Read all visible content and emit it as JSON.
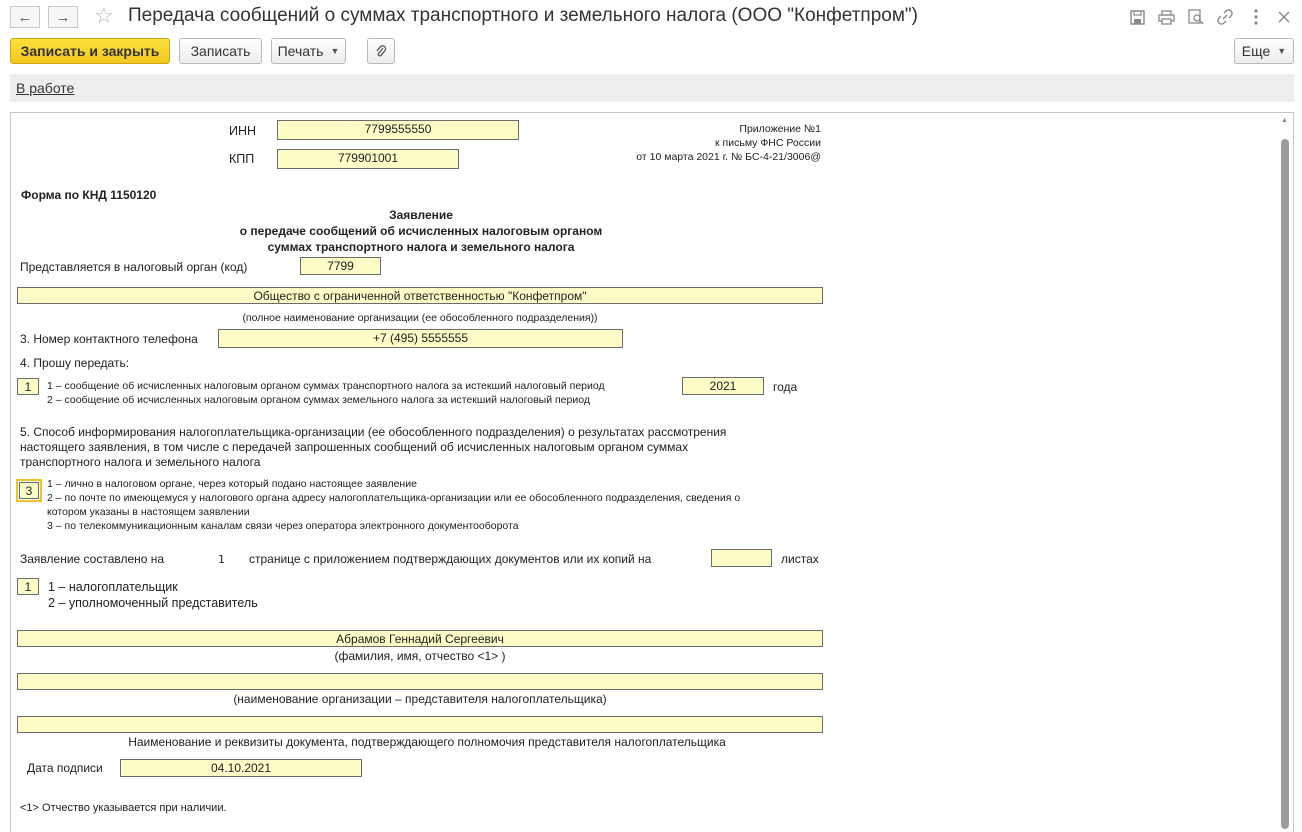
{
  "window": {
    "title": "Передача сообщений о суммах транспортного и земельного налога (ООО \"Конфетпром\")",
    "back_icon": "←",
    "forward_icon": "→",
    "star_icon": "☆"
  },
  "toolbar": {
    "save_close_label": "Записать и закрыть",
    "save_label": "Записать",
    "print_label": "Печать",
    "attach_icon": "paperclip",
    "more_label": "Еще"
  },
  "status": {
    "link_label": "В работе"
  },
  "form": {
    "inn_label": "ИНН",
    "inn_value": "7799555550",
    "kpp_label": "КПП",
    "kpp_value": "779901001",
    "appendix_line1": "Приложение №1",
    "appendix_line2": "к письму ФНС России",
    "appendix_line3": "от 10 марта 2021 г. № БС-4-21/3006@",
    "form_code": "Форма по КНД 1150120",
    "heading_line1": "Заявление",
    "heading_line2": "о передаче сообщений об исчисленных налоговым органом",
    "heading_line3": "суммах транспортного налога и земельного налога",
    "tax_authority_label": "Представляется в налоговый орган (код)",
    "tax_authority_value": "7799",
    "org_name_value": "Общество с ограниченной ответственностью \"Конфетпром\"",
    "org_name_caption": "(полное наименование организации (ее обособленного подразделения))",
    "phone_label": "3. Номер контактного телефона",
    "phone_value": "+7 (495) 5555555",
    "request_label": "4. Прошу передать:",
    "request_value": "1",
    "request_opt1": "1 – сообщение об исчисленных налоговым органом суммах транспортного налога за истекший налоговый период",
    "request_opt2": "2 – сообщение об исчисленных налоговым органом суммах земельного налога за истекший налоговый период",
    "year_value": "2021",
    "year_label": "года",
    "inform_line1": "5. Способ информирования налогоплательщика-организации (ее обособленного подразделения) о результатах рассмотрения",
    "inform_line2": "настоящего заявления, в том числе с передачей запрошенных сообщений об исчисленных налоговым органом суммах",
    "inform_line3": "транспортного налога и земельного налога",
    "inform_value": "3",
    "inform_opt1": "1 – лично в налоговом органе, через который подано настоящее заявление",
    "inform_opt2a": "2 – по почте по имеющемуся у налогового органа адресу налогоплательщика-организации или ее обособленного подразделения, сведения о",
    "inform_opt2b": "котором указаны в настоящем заявлении",
    "inform_opt3": "3 – по телекоммуникационным каналам связи через оператора электронного документооборота",
    "pages_label": "Заявление составлено на",
    "pages_value": "1",
    "pages_text": "странице с приложением подтверждающих документов или их копий на",
    "attach_pages_value": "",
    "attach_pages_label": "листах",
    "signer_value": "1",
    "signer_opt1": "1 – налогоплательщик",
    "signer_opt2": "2 – уполномоченный представитель",
    "fio_value": "Абрамов Геннадий Сергеевич",
    "fio_caption": "(фамилия, имя, отчество <1> )",
    "rep_org_value": "",
    "rep_org_caption": "(наименование организации – представителя налогоплательщика)",
    "rep_doc_value": "",
    "rep_doc_caption": "Наименование и реквизиты документа, подтверждающего полномочия представителя налогоплательщика",
    "sign_date_label": "Дата подписи",
    "sign_date_value": "04.10.2021",
    "footnote": "<1> Отчество указывается при наличии."
  },
  "colors": {
    "field_bg": "#fdfdc7",
    "primary_button": "#f3c81e",
    "status_strip": "#eeeeee"
  }
}
